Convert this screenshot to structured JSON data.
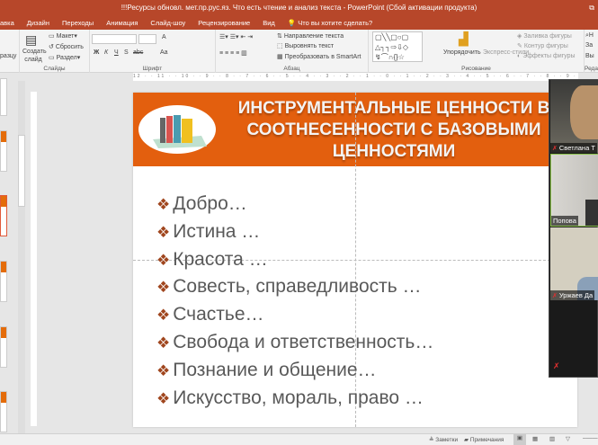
{
  "window": {
    "title": "!!!Ресурсы обновл. мет.пр.рус.яз. Что есть чтение и анализ текста - PowerPoint (Сбой активации продукта)"
  },
  "tabs": [
    "авка",
    "Дизайн",
    "Переходы",
    "Анимация",
    "Слайд-шоу",
    "Рецензирование",
    "Вид"
  ],
  "tell_me": "Что вы хотите сделать?",
  "ribbon": {
    "slides": {
      "label": "Слайды",
      "new_slide": "Создать слайд",
      "layout": "Макет",
      "reset": "Сбросить",
      "section": "Раздел",
      "left_cut": "разцу"
    },
    "font": {
      "label": "Шрифт",
      "bold": "Ж",
      "italic": "К",
      "underline": "Ч",
      "shadow": "S",
      "strike": "abc",
      "size_a": "A",
      "case": "Aa"
    },
    "paragraph": {
      "label": "Абзац",
      "text_direction": "Направление текста",
      "align_text": "Выровнять текст",
      "smartart": "Преобразовать в SmartArt"
    },
    "drawing": {
      "label": "Рисование",
      "arrange": "Упорядочить",
      "quick_styles": "Экспресс-стили",
      "fill": "Заливка фигуры",
      "outline": "Контур фигуры",
      "effects": "Эффекты фигуры"
    },
    "editing": {
      "label": "Реда",
      "find": "Н",
      "replace": "За",
      "select": "Вы"
    }
  },
  "ruler_text": "12 · · 11 · · 10 · · 9 · · 8 · · 7 · · 6 · · 5 · · 4 · · 3 · · 2 · · 1 · · 0 · · 1 · · 2 · · 3 · · 4 · · 5 · · 6 · · 7 · · 8 · · 9 · · 10 · · 11",
  "slide": {
    "title": "ИНСТРУМЕНТАЛЬНЫЕ ЦЕННОСТИ  В СООТНЕСЕННОСТИ С БАЗОВЫМИ ЦЕННОСТЯМИ",
    "bullet_glyph": "❖",
    "items": [
      "Добро…",
      "Истина …",
      "Красота …",
      "Совесть, справедливость …",
      "Счастье…",
      "Свобода и ответственность…",
      "Познание и общение…",
      "Искусство, мораль, право …"
    ],
    "colors": {
      "header": "#e35f0e",
      "bullet": "#a0461e",
      "text": "#595959"
    }
  },
  "video": {
    "participants": [
      {
        "name": "Светлана Т"
      },
      {
        "name": "Попова"
      },
      {
        "name": "Уржаев Да"
      }
    ]
  },
  "status": {
    "notes": "Заметки",
    "comments": "Примечания"
  }
}
